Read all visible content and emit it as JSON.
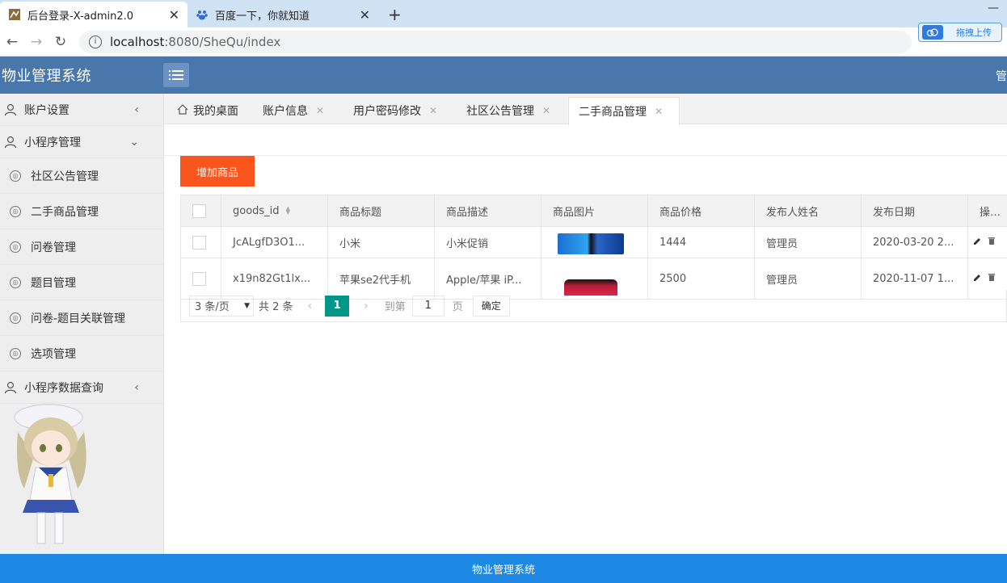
{
  "browser": {
    "tabs": [
      {
        "title": "后台登录-X-admin2.0",
        "active": true
      },
      {
        "title": "百度一下，你就知道",
        "active": false
      }
    ],
    "url_host": "localhost",
    "url_path": ":8080/SheQu/index",
    "upload_label": "拖拽上传"
  },
  "header": {
    "title": "物业管理系统",
    "admin_label": "管"
  },
  "sidebar": {
    "items": [
      {
        "label": "账户设置",
        "type": "top",
        "arrow": "<"
      },
      {
        "label": "小程序管理",
        "type": "top",
        "arrow": "v"
      },
      {
        "label": "社区公告管理",
        "type": "sub"
      },
      {
        "label": "二手商品管理",
        "type": "sub"
      },
      {
        "label": "问卷管理",
        "type": "sub"
      },
      {
        "label": "题目管理",
        "type": "sub"
      },
      {
        "label": "问卷-题目关联管理",
        "type": "sub"
      },
      {
        "label": "选项管理",
        "type": "sub"
      },
      {
        "label": "小程序数据查询",
        "type": "top",
        "arrow": "<"
      }
    ]
  },
  "content_tabs": [
    {
      "label": "我的桌面",
      "closable": false
    },
    {
      "label": "账户信息",
      "closable": true
    },
    {
      "label": "用户密码修改",
      "closable": true
    },
    {
      "label": "社区公告管理",
      "closable": true
    },
    {
      "label": "二手商品管理",
      "closable": true,
      "active": true
    }
  ],
  "toolbar": {
    "add_label": "增加商品"
  },
  "table": {
    "columns": [
      "goods_id",
      "商品标题",
      "商品描述",
      "商品图片",
      "商品价格",
      "发布人姓名",
      "发布日期",
      "操作"
    ],
    "rows": [
      {
        "id": "JcALgfD3O1...",
        "title": "小米",
        "desc": "小米促销",
        "price": "1444",
        "publisher": "管理员",
        "date": "2020-03-20 2..."
      },
      {
        "id": "x19n82Gt1lx...",
        "title": "苹果se2代手机",
        "desc": "Apple/苹果 iP...",
        "price": "2500",
        "publisher": "管理员",
        "date": "2020-11-07 1..."
      }
    ]
  },
  "pagination": {
    "page_size": "3 条/页",
    "total": "共 2 条",
    "current": "1",
    "goto_label": "到第",
    "goto_value": "1",
    "unit": "页",
    "confirm": "确定"
  },
  "footer": {
    "text": "物业管理系统"
  },
  "colors": {
    "header_bg": "#4a77ab",
    "add_button": "#f8561d",
    "pager_active": "#009688",
    "footer_bg": "#1e88e5"
  }
}
